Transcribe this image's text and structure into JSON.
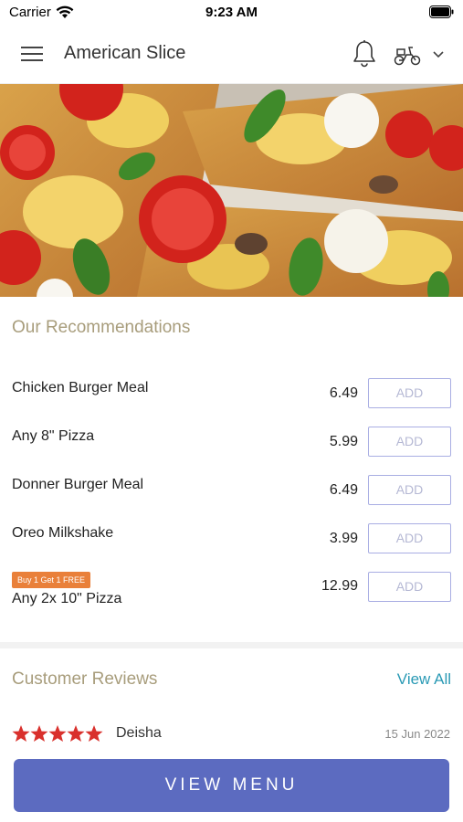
{
  "status_bar": {
    "carrier": "Carrier",
    "time": "9:23 AM"
  },
  "header": {
    "title": "American Slice",
    "menu_icon": "hamburger-menu-icon",
    "notification_icon": "bell-icon",
    "delivery_icon": "scooter-icon",
    "dropdown_icon": "chevron-down-icon"
  },
  "hero": {
    "image_subject": "pizza"
  },
  "recommendations": {
    "title": "Our Recommendations",
    "add_label": "ADD",
    "items": [
      {
        "name": "Chicken Burger Meal",
        "price": "6.49",
        "badge": ""
      },
      {
        "name": "Any 8\" Pizza",
        "price": "5.99",
        "badge": ""
      },
      {
        "name": "Donner Burger Meal",
        "price": "6.49",
        "badge": ""
      },
      {
        "name": "Oreo Milkshake",
        "price": "3.99",
        "badge": ""
      },
      {
        "name": "Any 2x 10\" Pizza",
        "price": "12.99",
        "badge": "Buy 1 Get 1 FREE"
      }
    ]
  },
  "reviews": {
    "title": "Customer Reviews",
    "view_all_label": "View All",
    "items": [
      {
        "reviewer": "Deisha",
        "date": "15 Jun 2022",
        "rating": 5
      }
    ]
  },
  "footer": {
    "view_menu_label": "VIEW MENU"
  },
  "colors": {
    "accent": "#5c6bc0",
    "section_title": "#a89d7c",
    "link": "#2a9ab5",
    "star": "#d9302c",
    "promo": "#e9803a",
    "add_border": "#a9aee3"
  }
}
